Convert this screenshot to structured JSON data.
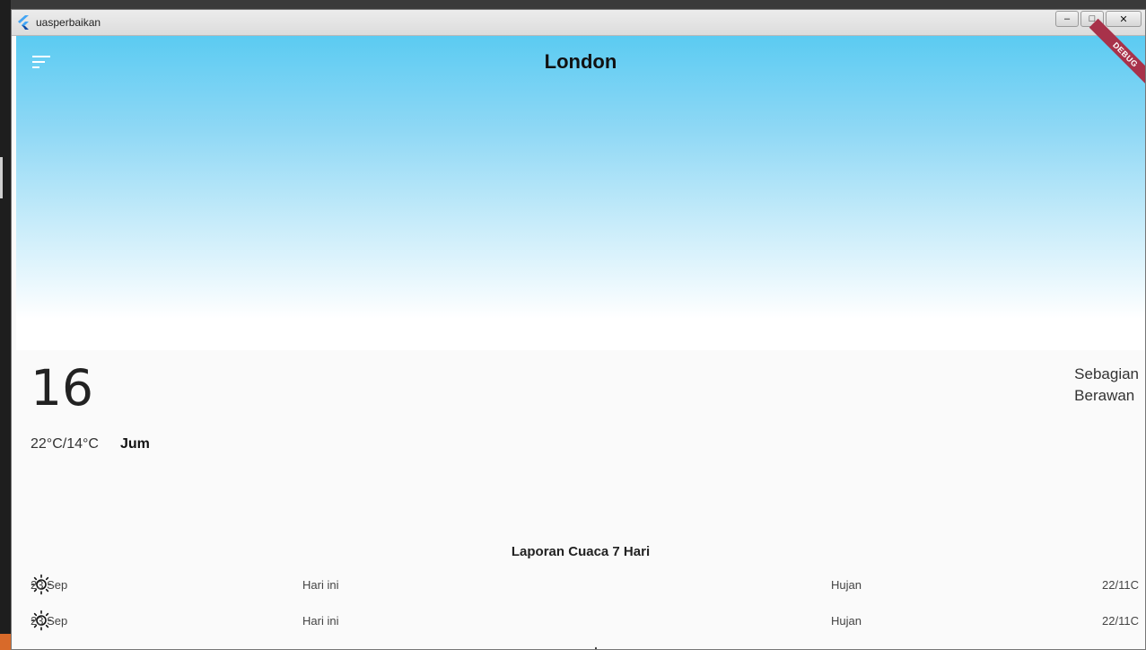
{
  "window": {
    "title": "uasperbaikan",
    "minimize_label": "–",
    "maximize_label": "□",
    "close_label": "✕"
  },
  "header": {
    "city": "London",
    "debug_label": "DEBUG",
    "gradient_colors": [
      "#5bcbf2",
      "#ffffff"
    ]
  },
  "current": {
    "temperature": "16",
    "condition_line1": "Sebagian",
    "condition_line2": "Berawan",
    "range": "22°C/14°C",
    "day": "Jum"
  },
  "report": {
    "title": "Laporan Cuaca 7 Hari",
    "rows": [
      {
        "date": "23 Sep",
        "label": "Hari ini",
        "icon": "sun-icon",
        "condition": "Hujan",
        "range": "22/11C"
      },
      {
        "date": "23 Sep",
        "label": "Hari ini",
        "icon": "sun-icon",
        "condition": "Hujan",
        "range": "22/11C"
      }
    ]
  }
}
